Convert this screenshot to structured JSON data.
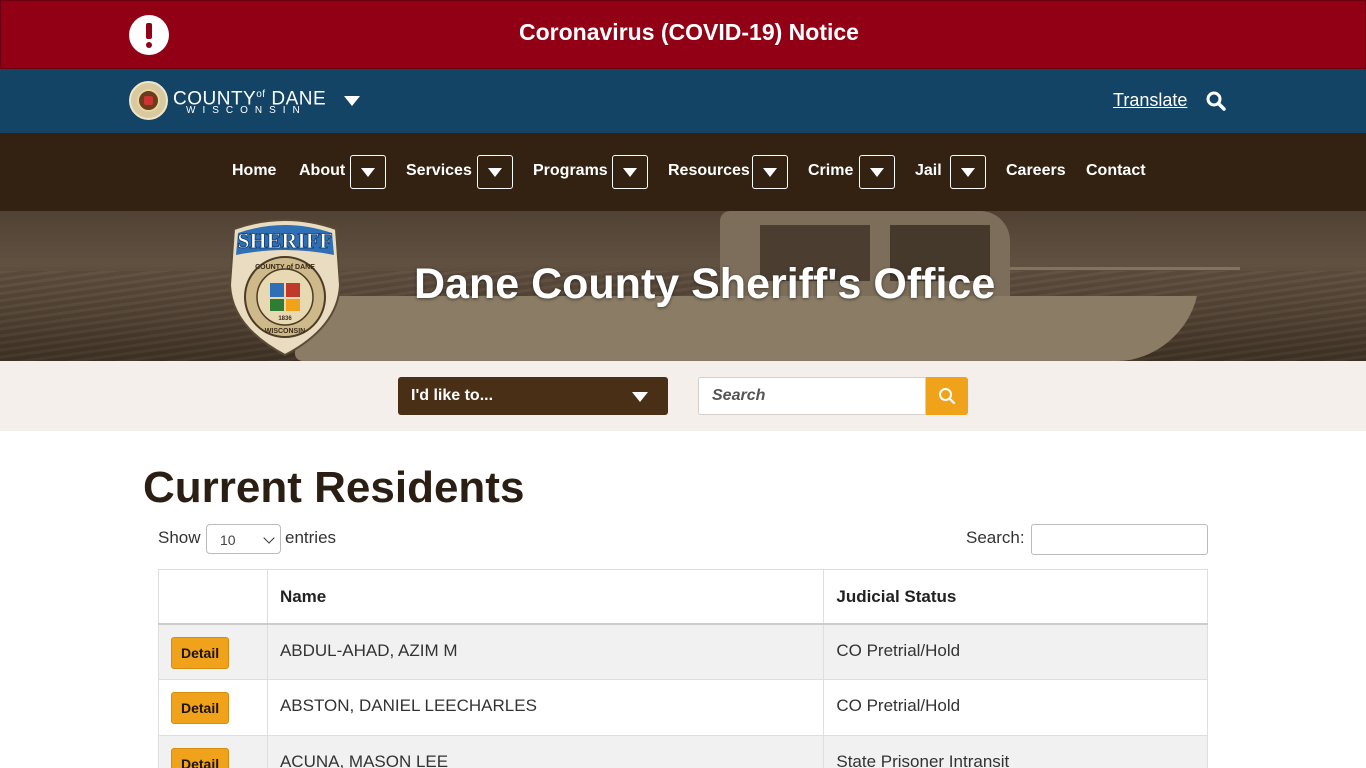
{
  "covid": {
    "notice": "Coronavirus (COVID-19) Notice"
  },
  "county": {
    "name_left": "COUNTY",
    "name_of": "of",
    "name_right": "DANE",
    "state": "WISCONSIN",
    "translate": "Translate"
  },
  "nav": {
    "home": "Home",
    "about": "About",
    "services": "Services",
    "programs": "Programs",
    "resources": "Resources",
    "crime": "Crime",
    "jail": "Jail",
    "careers": "Careers",
    "contact": "Contact"
  },
  "hero": {
    "title": "Dane County Sheriff's Office",
    "badge_text": "SHERIFF",
    "badge_county": "COUNTY of DANE",
    "badge_state": "WISCONSIN",
    "badge_year": "1836"
  },
  "action_bar": {
    "ilike": "I'd like to...",
    "search_placeholder": "Search"
  },
  "content": {
    "title": "Current Residents",
    "show": "Show",
    "entries_value": "10",
    "entries": "entries",
    "search_label": "Search:",
    "columns": [
      "",
      "Name",
      "Judicial Status"
    ],
    "rows": [
      {
        "button": "Detail",
        "name": "ABDUL-AHAD, AZIM M",
        "status": "CO Pretrial/Hold"
      },
      {
        "button": "Detail",
        "name": "ABSTON, DANIEL LEECHARLES",
        "status": "CO Pretrial/Hold"
      },
      {
        "button": "Detail",
        "name": "ACUNA, MASON LEE",
        "status": "State Prisoner Intransit"
      }
    ]
  },
  "colors": {
    "covid_red": "#910014",
    "county_blue": "#134466",
    "nav_brown": "#332211",
    "accent_orange": "#f0a21a",
    "ilike_brown": "#4a2f17"
  }
}
